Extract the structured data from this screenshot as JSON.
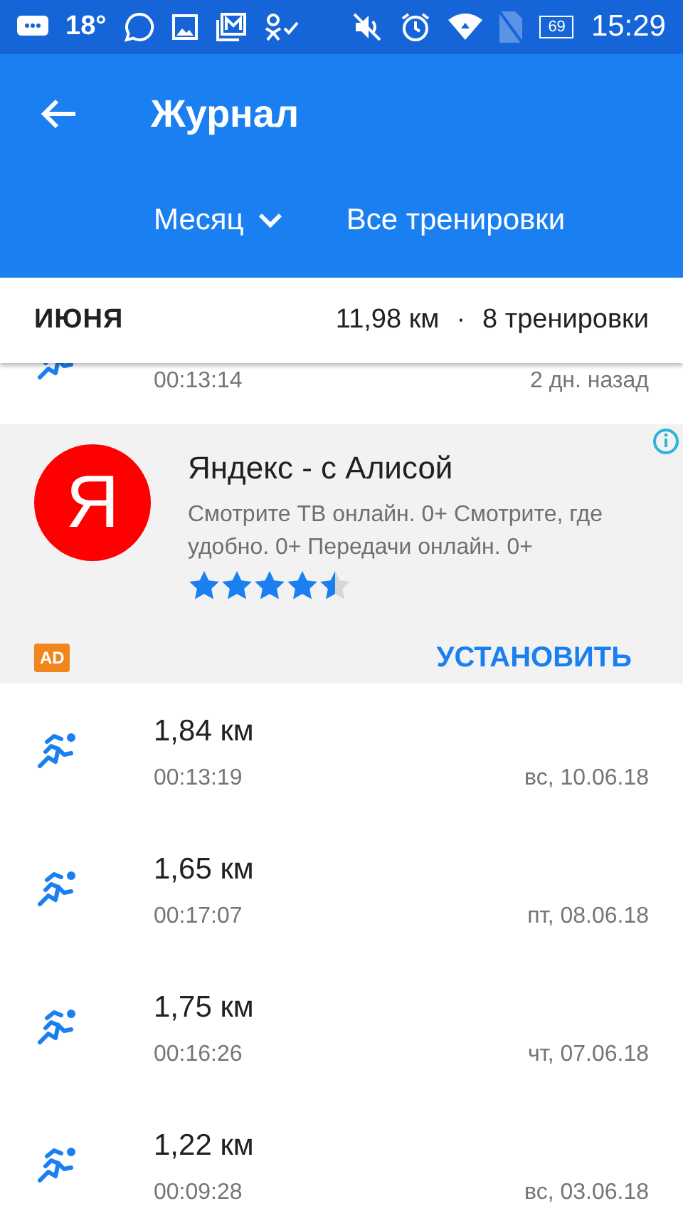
{
  "status_bar": {
    "temperature": "18°",
    "battery": "69",
    "time": "15:29"
  },
  "toolbar": {
    "title": "Журнал"
  },
  "filters": [
    {
      "label": "Месяц",
      "kind": "dropdown"
    },
    {
      "label": "Все тренировки",
      "kind": "plain"
    }
  ],
  "section": {
    "month": "ИЮНЯ",
    "distance": "11,98 км",
    "separator": "·",
    "count": "8 тренировки"
  },
  "partial_workout": {
    "duration": "00:13:14",
    "date": "2 дн. назад"
  },
  "ad": {
    "logo_letter": "Я",
    "title": "Яндекс - с Алисой",
    "description": "Смотрите ТВ онлайн. 0+ Смотрите, где удобно. 0+ Передачи онлайн. 0+",
    "stars": 4.5,
    "badge": "AD",
    "action": "УСТАНОВИТЬ"
  },
  "workouts": [
    {
      "distance": "1,84 км",
      "duration": "00:13:19",
      "date": "вс, 10.06.18"
    },
    {
      "distance": "1,65 км",
      "duration": "00:17:07",
      "date": "пт, 08.06.18"
    },
    {
      "distance": "1,75 км",
      "duration": "00:16:26",
      "date": "чт, 07.06.18"
    },
    {
      "distance": "1,22 км",
      "duration": "00:09:28",
      "date": "вс, 03.06.18"
    }
  ]
}
